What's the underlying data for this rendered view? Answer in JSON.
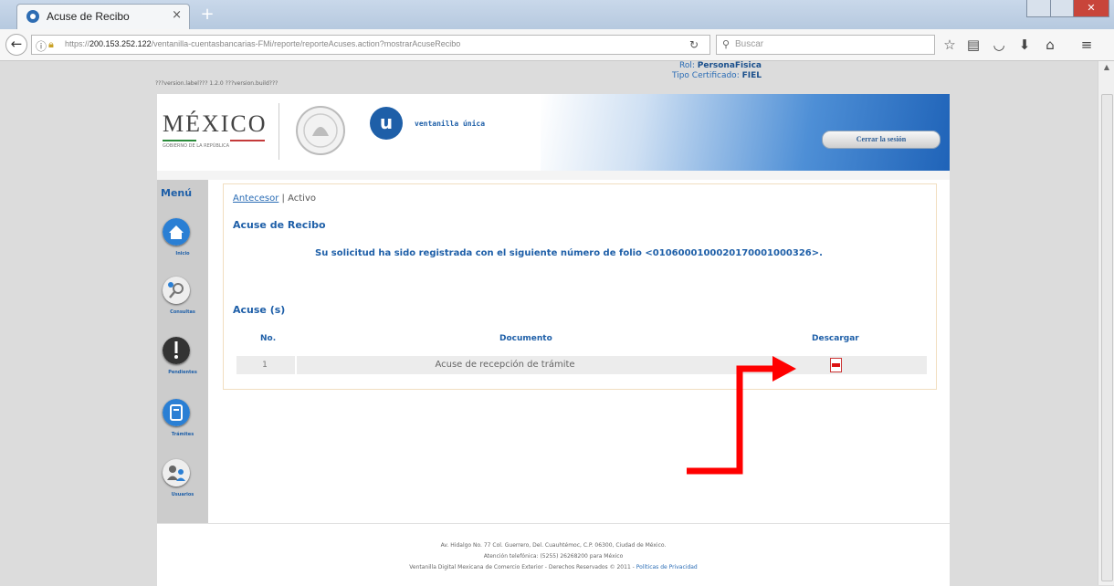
{
  "browser": {
    "tab_title": "Acuse de Recibo",
    "tab_close": "×",
    "new_tab": "+",
    "url_prefix": "https://",
    "url_host": "200.153.252.122",
    "url_path": "/ventanilla-cuentasbancarias-FMi/reporte/reporteAcuses.action?mostrarAcuseRecibo",
    "search_placeholder": "Buscar"
  },
  "user": {
    "role_label": "Rol:",
    "role_value": "PersonaFisica",
    "cert_label": "Tipo Certificado:",
    "cert_value": "FIEL"
  },
  "version_label": "???version.label??? 1.2.0 ???version.build???",
  "header": {
    "mexico": "MÉXICO",
    "mexico_sub": "GOBIERNO DE LA REPÚBLICA",
    "vu_letter": "u",
    "vu_text": "ventanilla única",
    "logout": "Cerrar la sesión"
  },
  "menu": {
    "title": "Menú",
    "items": [
      {
        "label": "Inicio",
        "color": "#2a7fd4"
      },
      {
        "label": "Consultas",
        "color": "#eeeeee"
      },
      {
        "label": "Pendientes",
        "color": "#333333"
      },
      {
        "label": "Trámites",
        "color": "#2a7fd4"
      },
      {
        "label": "Usuarios",
        "color": "#eeeeee"
      }
    ]
  },
  "breadcrumb": {
    "link": "Antecesor",
    "separator": " | ",
    "current": "Activo"
  },
  "page_title": "Acuse de Recibo",
  "message": "Su solicitud ha sido registrada con el siguiente número de folio <0106000100020170001000326>.",
  "acuses": {
    "title": "Acuse (s)",
    "headers": {
      "no": "No.",
      "documento": "Documento",
      "descargar": "Descargar"
    },
    "rows": [
      {
        "no": "1",
        "documento": "Acuse de recepción de trámite",
        "icon": "pdf-icon"
      }
    ]
  },
  "footer": {
    "line1": "Av. Hidalgo No. 77 Col. Guerrero, Del. Cuauhtémoc, C.P. 06300, Ciudad de México.",
    "line2": "Atención telefónica: (5255) 26268200 para México",
    "line3": "Ventanilla Digital Mexicana de Comercio Exterior - Derechos Reservados © 2011 -",
    "privacy": "Políticas de Privacidad"
  },
  "colors": {
    "accent": "#1e5fa8",
    "arrow": "#ff0000"
  }
}
